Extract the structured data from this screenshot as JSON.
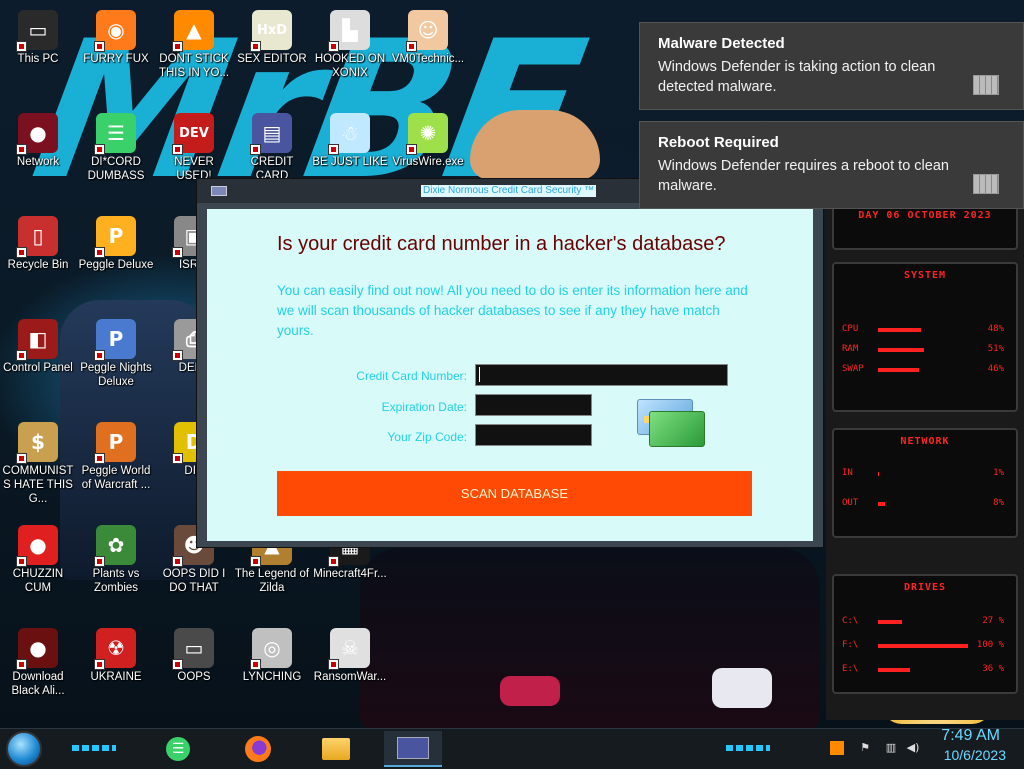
{
  "desktop_icons": [
    {
      "label": "This PC",
      "icon": "this-pc-icon",
      "color": "#2a2a2a",
      "glyph": "▭"
    },
    {
      "label": "FURRY FUX",
      "icon": "firefox-icon",
      "color": "#ff7a1a",
      "glyph": "◉"
    },
    {
      "label": "DONT STICK THIS IN YO...",
      "icon": "vlc-cone-icon",
      "color": "#ff8a00",
      "glyph": "▲"
    },
    {
      "label": "SEX EDITOR",
      "icon": "hxd-editor-icon",
      "color": "#e8e8d0",
      "glyph": "HxD"
    },
    {
      "label": "HOOKED ON XONIX",
      "icon": "xonix-game-icon",
      "color": "#dddddd",
      "glyph": "▙"
    },
    {
      "label": "VM0Technic...",
      "icon": "doctor-icon",
      "color": "#f1c8a0",
      "glyph": "☺"
    },
    {
      "label": "Network",
      "icon": "network-orb-icon",
      "color": "#7a1020",
      "glyph": "●"
    },
    {
      "label": "DI*CORD DUMBASS",
      "icon": "discord-icon",
      "color": "#3ad06a",
      "glyph": "☰"
    },
    {
      "label": "NEVER USED!",
      "icon": "devcpp-icon",
      "color": "#c41b1b",
      "glyph": "DEV"
    },
    {
      "label": "CREDIT CARD",
      "icon": "credit-card-app-icon",
      "color": "#4a55a0",
      "glyph": "▤"
    },
    {
      "label": "BE JUST LIKE",
      "icon": "santa-icon",
      "color": "#c0e8ff",
      "glyph": "☃"
    },
    {
      "label": "VirusWire.exe",
      "icon": "lime-icon",
      "color": "#9de04a",
      "glyph": "✺"
    },
    {
      "label": "Recycle Bin",
      "icon": "recycle-bin-icon",
      "color": "#c83030",
      "glyph": "▯"
    },
    {
      "label": "Peggle Deluxe",
      "icon": "peggle-icon",
      "color": "#ffb020",
      "glyph": "P"
    },
    {
      "label": "ISRAI",
      "icon": "unknown-app-icon",
      "color": "#888888",
      "glyph": "▣"
    },
    {
      "label": "Control Panel",
      "icon": "control-panel-icon",
      "color": "#9b1b1b",
      "glyph": "◧"
    },
    {
      "label": "Peggle Nights Deluxe",
      "icon": "peggle-nights-icon",
      "color": "#4a7ad0",
      "glyph": "P"
    },
    {
      "label": "DEEZ",
      "icon": "printer-icon",
      "color": "#9a9a9a",
      "glyph": "⎙"
    },
    {
      "label": "COMMUNISTS HATE THIS G...",
      "icon": "money-bag-icon",
      "color": "#c8a050",
      "glyph": "$"
    },
    {
      "label": "Peggle World of Warcraft ...",
      "icon": "peggle-wow-icon",
      "color": "#e07020",
      "glyph": "P"
    },
    {
      "label": "DIE",
      "icon": "die-app-icon",
      "color": "#e0c000",
      "glyph": "D"
    },
    {
      "label": "CHUZZIN CUM",
      "icon": "chuzzle-icon",
      "color": "#e02020",
      "glyph": "●"
    },
    {
      "label": "Plants vs Zombies",
      "icon": "pvz-icon",
      "color": "#3a8a3a",
      "glyph": "✿"
    },
    {
      "label": "OOPS DID I DO THAT",
      "icon": "person-photo-icon",
      "color": "#6a4a3a",
      "glyph": "☻"
    },
    {
      "label": "The Legend of Zilda",
      "icon": "zelda-icon",
      "color": "#b08030",
      "glyph": "▲"
    },
    {
      "label": "Minecraft4Fr...",
      "icon": "minecraft-icon",
      "color": "#1a1a1a",
      "glyph": "▦"
    },
    {
      "label": "Download Black Ali...",
      "icon": "download-orb-icon",
      "color": "#6a1010",
      "glyph": "●"
    },
    {
      "label": "UKRAINE",
      "icon": "radiation-icon",
      "color": "#d02020",
      "glyph": "☢"
    },
    {
      "label": "OOPS",
      "icon": "monitor-app-icon",
      "color": "#4a4a4a",
      "glyph": "▭"
    },
    {
      "label": "LYNCHING",
      "icon": "noose-icon",
      "color": "#c0c0c0",
      "glyph": "◎"
    },
    {
      "label": "RansomWar...",
      "icon": "skull-icon",
      "color": "#e0e0e0",
      "glyph": "☠"
    }
  ],
  "wallpaper": {
    "graffiti_text": "MrBE"
  },
  "scam_window": {
    "title": "Dixie Normous Credit Card Security ™",
    "headline": "Is your credit card number in a hacker's database?",
    "description": "You can easily find out now! All you need to do is enter its information here and we will scan thousands of hacker databases to see if any they have match yours.",
    "fields": {
      "card_number_label": "Credit Card Number:",
      "card_number_value": "",
      "expiration_label": "Expiration Date:",
      "expiration_value": "",
      "zip_label": "Your Zip Code:",
      "zip_value": ""
    },
    "scan_button": "SCAN DATABASE",
    "colors": {
      "headline": "#6a0000",
      "text": "#22d1e4",
      "button": "#ff4a05",
      "background": "#d8fbf9"
    }
  },
  "notifications": [
    {
      "title": "Malware Detected",
      "body": "Windows Defender is taking action to clean detected malware."
    },
    {
      "title": "Reboot Required",
      "body": "Windows Defender requires a reboot to clean malware."
    }
  ],
  "gadget": {
    "date_text": "DAY 06 OCTOBER 2023",
    "system": {
      "title": "SYSTEM",
      "rows": [
        {
          "label": "CPU",
          "value": "48%"
        },
        {
          "label": "RAM",
          "value": "51%"
        },
        {
          "label": "SWAP",
          "value": "46%"
        }
      ]
    },
    "network": {
      "title": "NETWORK",
      "rows": [
        {
          "label": "IN",
          "value": "1%"
        },
        {
          "label": "OUT",
          "value": "8%"
        }
      ]
    },
    "drives": {
      "title": "DRIVES",
      "rows": [
        {
          "label": "C:\\",
          "value": "27 %"
        },
        {
          "label": "F:\\",
          "value": "100 %"
        },
        {
          "label": "E:\\",
          "value": "36 %"
        }
      ]
    }
  },
  "taskbar": {
    "apps": [
      {
        "name": "discord",
        "icon": "discord-icon"
      },
      {
        "name": "firefox",
        "icon": "firefox-icon"
      },
      {
        "name": "file-explorer",
        "icon": "folder-icon"
      },
      {
        "name": "credit-card-app",
        "icon": "credit-card-app-icon"
      }
    ],
    "time": "7:49 AM",
    "date": "10/6/2023"
  }
}
